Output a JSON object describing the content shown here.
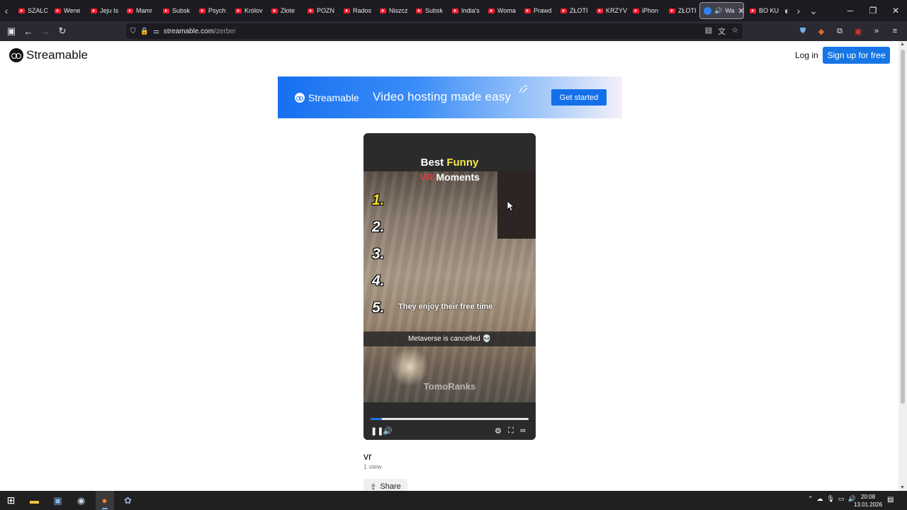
{
  "browser": {
    "tabs": [
      {
        "label": "SZALC"
      },
      {
        "label": "Wene"
      },
      {
        "label": "Jeju Is"
      },
      {
        "label": "Mamr"
      },
      {
        "label": "Subsk"
      },
      {
        "label": "Psych"
      },
      {
        "label": "Królov"
      },
      {
        "label": "Złote"
      },
      {
        "label": "POZN"
      },
      {
        "label": "Rados"
      },
      {
        "label": "Niszcz"
      },
      {
        "label": "Subsk"
      },
      {
        "label": "India's"
      },
      {
        "label": "Woma"
      },
      {
        "label": "Prawd"
      },
      {
        "label": "ZŁOTI"
      },
      {
        "label": "KRZYV"
      },
      {
        "label": "iPhon"
      },
      {
        "label": "ZŁOTI"
      }
    ],
    "active_tab": {
      "label": "Wa"
    },
    "extra_tab": {
      "label": "BO KU"
    },
    "url_host": "streamable.com",
    "url_path": "/zerbei"
  },
  "site": {
    "logo_text": "Streamable",
    "login_label": "Log in",
    "signup_label": "Sign up for free"
  },
  "banner": {
    "logo_text": "Streamable",
    "tagline": "Video hosting made easy",
    "cta_label": "Get started"
  },
  "video": {
    "title_best": "Best",
    "title_funny": "Funny",
    "title_vr": "VR",
    "title_moments": "Moments",
    "numbers": [
      "1.",
      "2.",
      "3.",
      "4.",
      "5."
    ],
    "caption_5": "They enjoy their free time",
    "bottom_text": "Metaverse is cancelled 💀",
    "watermark": "TomoRanks",
    "progress": 0.07,
    "name": "vr",
    "views": "1 view",
    "share_label": "Share"
  },
  "taskbar": {
    "time": "20:08",
    "date": "13.01.2026"
  },
  "colors": {
    "brand_blue": "#1676e6",
    "tab_bg": "#1c1b22",
    "nav_bg": "#2b2a33",
    "funny_yellow": "#f6e84a",
    "vr_red": "#e23b3b"
  }
}
